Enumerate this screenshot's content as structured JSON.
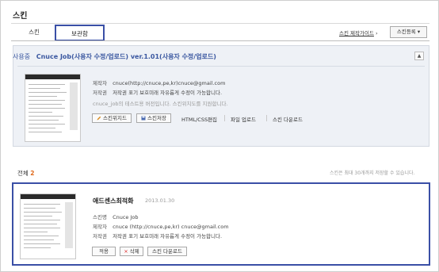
{
  "page": {
    "title": "스킨"
  },
  "tabs": [
    {
      "label": "스킨",
      "active": false
    },
    {
      "label": "보관함",
      "active": true
    }
  ],
  "toolbar": {
    "guide_label": "스킨 제작가이드",
    "guide_arrow": "›",
    "register_label": "스킨등록",
    "register_arrow": "▾"
  },
  "current": {
    "status": "사용중",
    "title": "Cnuce Job(사용자 수정/업로드) ver.1.01(사용자 수정/업로드)",
    "collapse_icon": "▲",
    "rows": [
      {
        "label": "제작자",
        "value": "cnuce(http://cnuce,pe,kr)cnuce@gmail.com"
      },
      {
        "label": "저작권",
        "value": "저작권 표기 보호미래 자유롭게 수정이 가능합니다."
      }
    ],
    "note": "cnuce_job의 테스트용 버전입니다. 스킨위치도를 지원합니다.",
    "actions": {
      "edit_label": "스킨위지드",
      "edit_icon": "pencil-icon",
      "save_label": "스킨저장",
      "save_icon": "disk-icon",
      "html_css_label": "HTML/CSS편집",
      "file_upload_label": "파일 업로드",
      "download_label": "스킨 다운로드"
    }
  },
  "list": {
    "total_label": "전체",
    "total_count": "2",
    "limit_note": "스킨은 최대 30개까지 저장할 수 있습니다.",
    "items": [
      {
        "name": "애드센스최적화",
        "date": "2013.01.30",
        "rows": [
          {
            "label": "스킨명",
            "value": "Cnuce Job"
          },
          {
            "label": "제작자",
            "value": "cnuce (http://cnuce,pe,kr) cnuce@gmail.com"
          },
          {
            "label": "저작권",
            "value": "저작권 표기 보호미래 자유롭게 수정이 가능합니다."
          }
        ],
        "actions": {
          "apply_label": "적용",
          "delete_label": "삭제",
          "delete_icon": "×",
          "download_label": "스킨 다운로드"
        }
      }
    ]
  },
  "colors": {
    "accent_border": "#3a4fa6",
    "count_highlight": "#e06a1b",
    "panel_bg": "#eef1f6",
    "title_blue": "#3a57a0"
  }
}
